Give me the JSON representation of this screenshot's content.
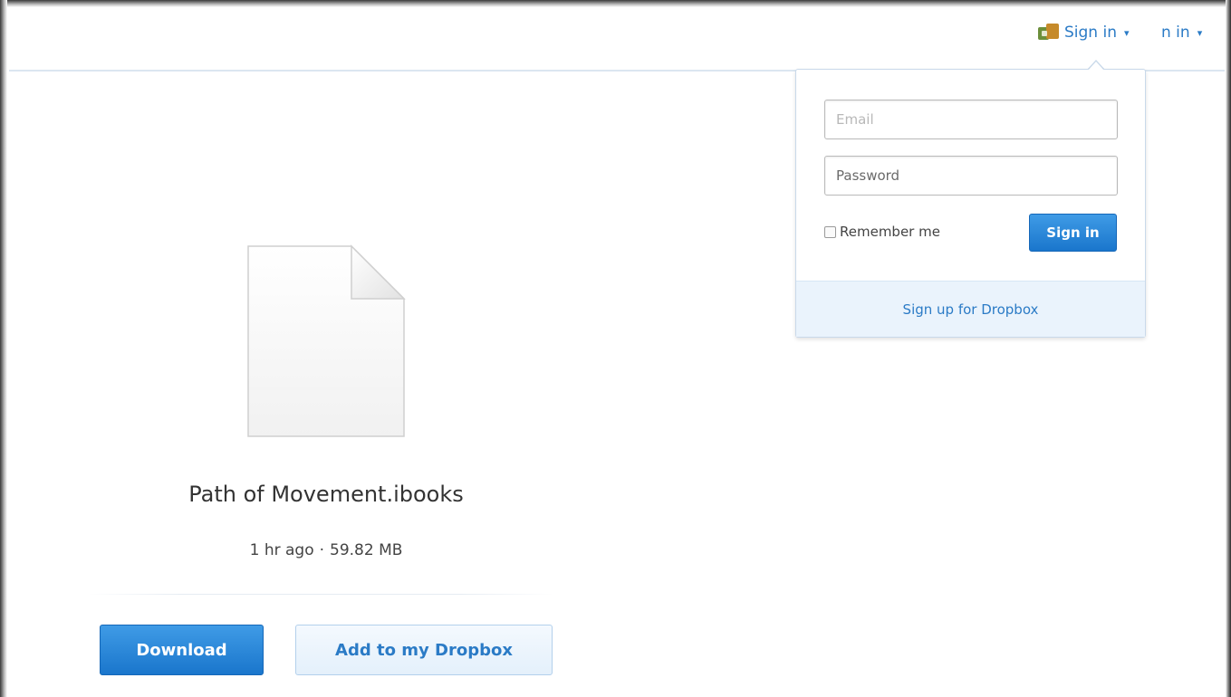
{
  "header": {
    "signin_label": "Sign in",
    "signin_ghost_label": "n in",
    "caret": "▾",
    "accent_color": "#2b7bc6"
  },
  "signin_dropdown": {
    "email_placeholder": "Email",
    "password_placeholder": "Password",
    "remember_label": "Remember me",
    "signin_button": "Sign in",
    "signup_link": "Sign up for Dropbox"
  },
  "file": {
    "icon": "document-icon",
    "name": "Path of Movement.ibooks",
    "modified": "1 hr ago",
    "separator": "·",
    "size": "59.82 MB"
  },
  "actions": {
    "download_label": "Download",
    "add_label": "Add to my Dropbox"
  }
}
